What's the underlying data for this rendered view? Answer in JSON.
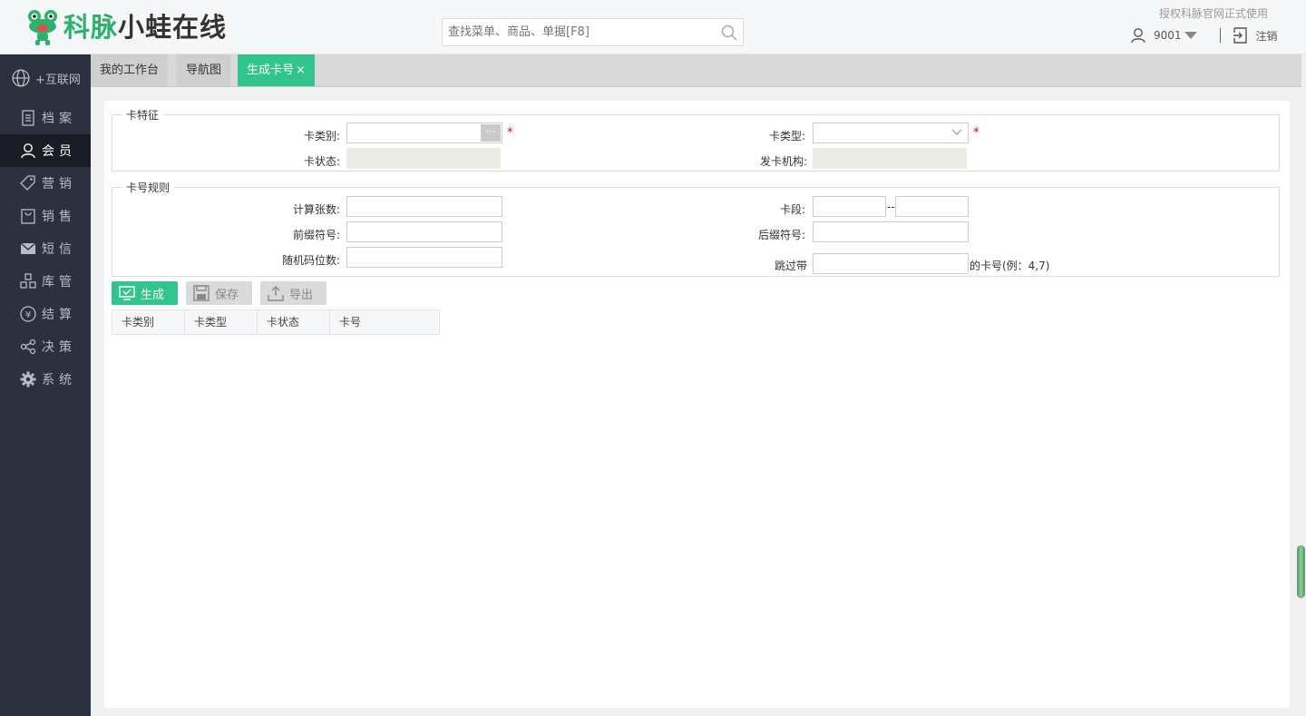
{
  "header": {
    "logo": {
      "part1": "科脉",
      "part2": "小蛙在线"
    },
    "search_placeholder": "查找菜单、商品、单据[F8]",
    "auth_notice": "授权科脉官网正式使用",
    "user_id": "9001",
    "logout_label": "注销"
  },
  "sidebar": {
    "internet": "+互联网",
    "items": [
      {
        "label": "档案",
        "icon": "file-icon"
      },
      {
        "label": "会员",
        "icon": "user-icon"
      },
      {
        "label": "营销",
        "icon": "tag-icon"
      },
      {
        "label": "销售",
        "icon": "bag-icon"
      },
      {
        "label": "短信",
        "icon": "mail-icon"
      },
      {
        "label": "库管",
        "icon": "warehouse-icon"
      },
      {
        "label": "结算",
        "icon": "yen-icon"
      },
      {
        "label": "决策",
        "icon": "share-icon"
      },
      {
        "label": "系统",
        "icon": "gear-icon"
      }
    ],
    "active_index": 1
  },
  "tabs": [
    {
      "label": "我的工作台"
    },
    {
      "label": "导航图"
    },
    {
      "label": "生成卡号",
      "close": "×"
    }
  ],
  "card_features": {
    "legend": "卡特征",
    "card_category_label": "卡类别:",
    "card_type_label": "卡类型:",
    "card_status_label": "卡状态:",
    "issuer_label": "发卡机构:",
    "required_mark": "*",
    "more_button": "···"
  },
  "card_rules": {
    "legend": "卡号规则",
    "count_label": "计算张数:",
    "segment_label": "卡段:",
    "segment_sep": "--",
    "prefix_label": "前缀符号:",
    "suffix_label": "后缀符号:",
    "random_label": "随机码位数:",
    "skip_label": "跳过带",
    "skip_suffix": "的卡号(例：4,7)"
  },
  "actions": {
    "generate": "生成",
    "save": "保存",
    "export": "导出"
  },
  "table": {
    "columns": [
      "卡类别",
      "卡类型",
      "卡状态",
      "卡号"
    ]
  },
  "colors": {
    "accent": "#31c48d",
    "sidebar_bg": "#2c3140",
    "required": "#cc0000"
  }
}
